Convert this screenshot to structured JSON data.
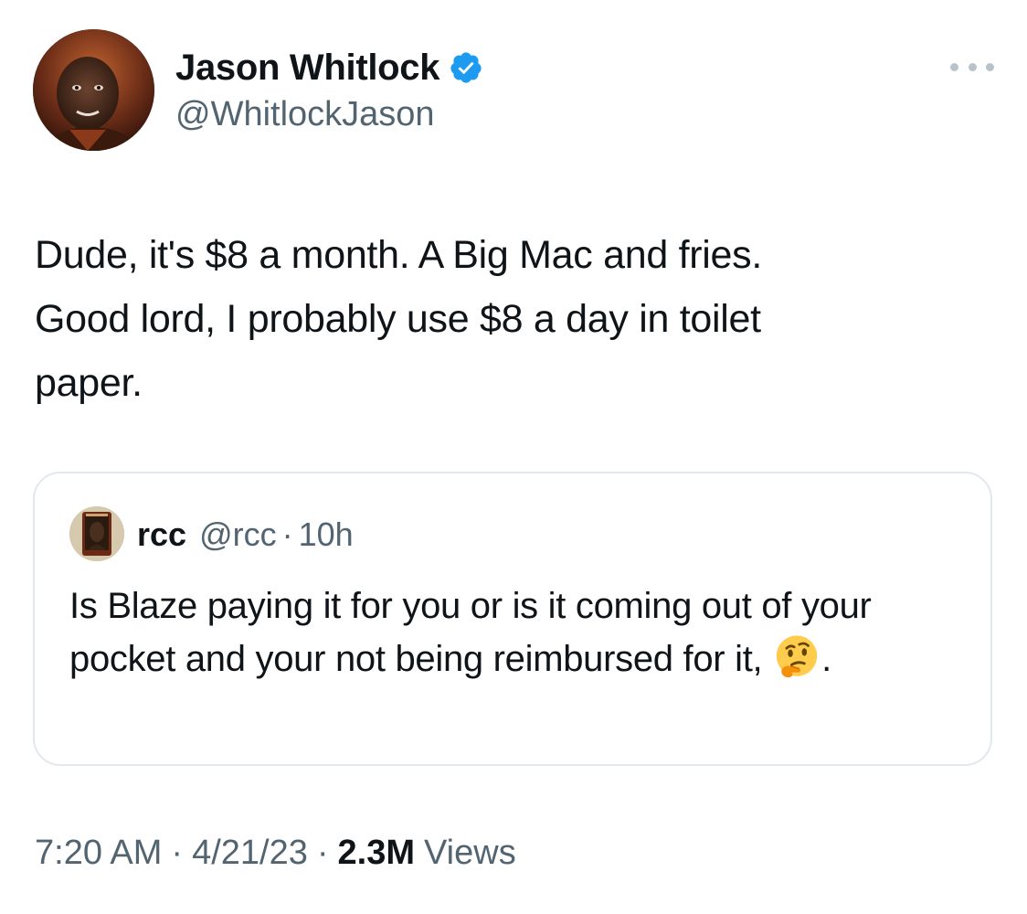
{
  "author": {
    "name": "Jason Whitlock",
    "handle": "@WhitlockJason",
    "verified": true
  },
  "tweet": {
    "text": "Dude, it's $8 a month. A Big Mac and fries.\nGood lord, I probably use $8 a day in toilet\npaper."
  },
  "quoted_tweet": {
    "name": "rcc",
    "handle": "@rcc",
    "separator": "·",
    "time": "10h",
    "text_before_emoji": "Is Blaze paying it for you or is it coming out of your pocket and your not being reimbursed for it,",
    "emoji_icon": "thinking-face-emoji",
    "text_after_emoji": "."
  },
  "meta": {
    "time": "7:20 AM",
    "separator": "·",
    "date": "4/21/23",
    "views_count": "2.3M",
    "views_label": "Views"
  },
  "icons": {
    "verified": "verified-badge-icon",
    "more": "more-options-icon"
  },
  "colors": {
    "verified_blue": "#1d9bf0",
    "text_primary": "#0f1419",
    "text_secondary": "#536471",
    "border": "#e3e8ec"
  }
}
